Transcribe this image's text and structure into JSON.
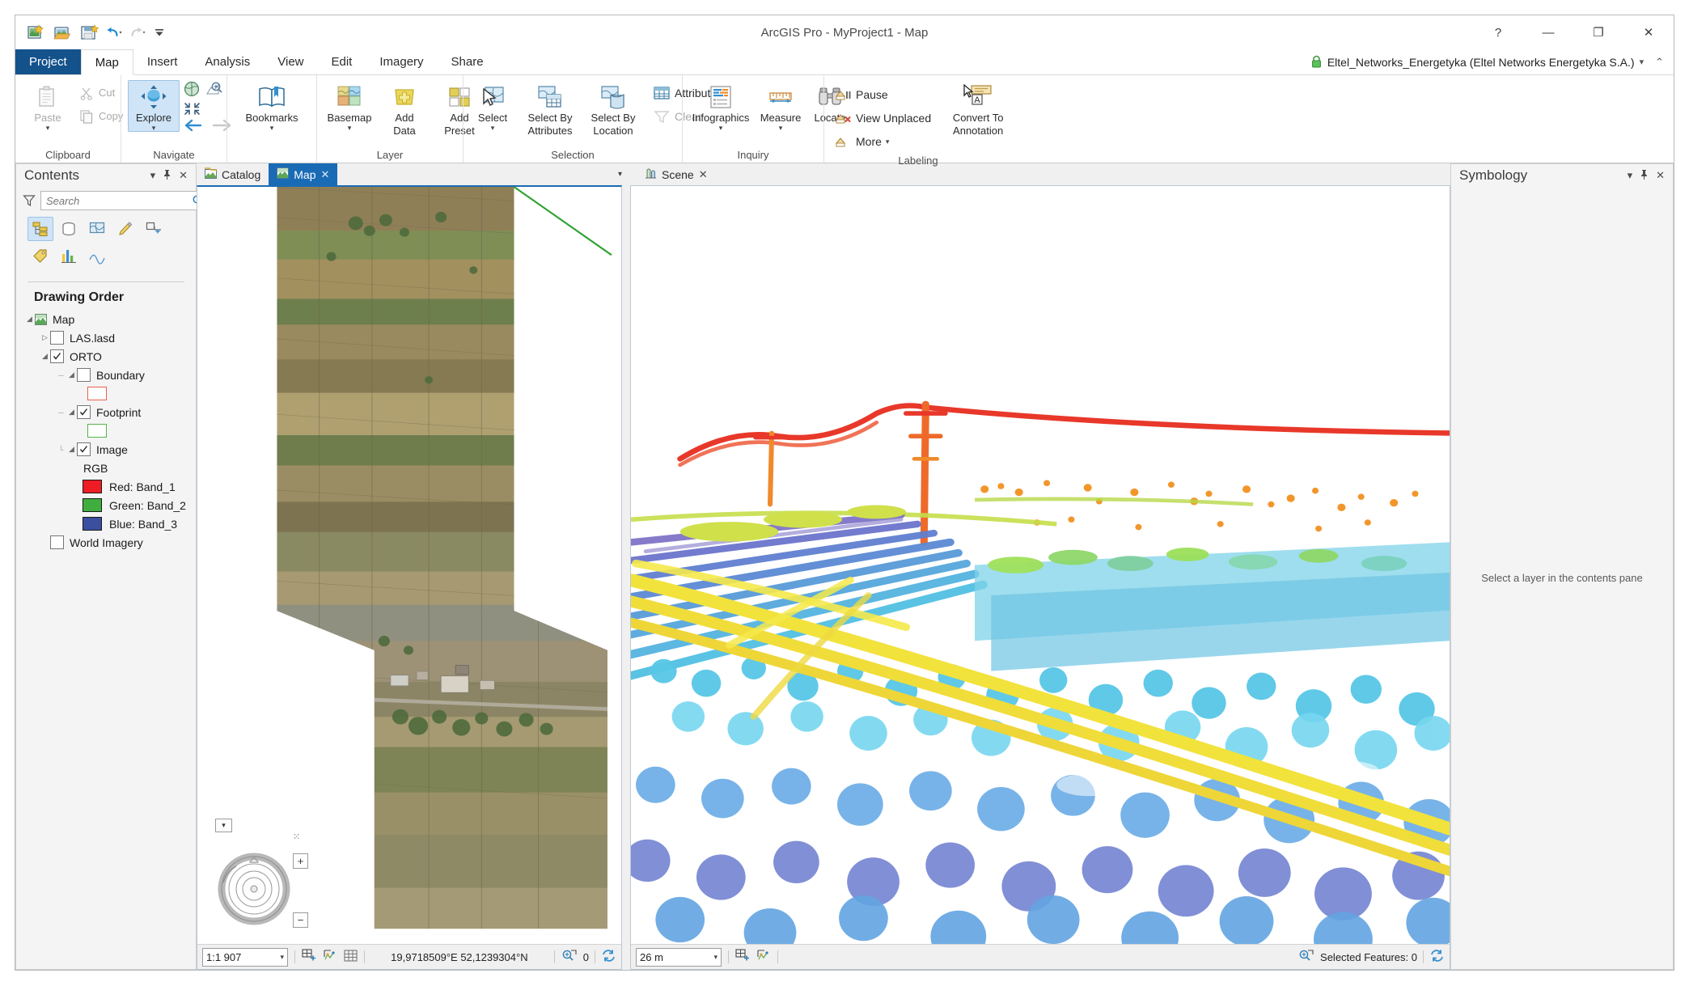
{
  "window": {
    "title": "ArcGIS Pro - MyProject1 - Map",
    "help_label": "?",
    "minimize_label": "—",
    "restore_label": "❐",
    "close_label": "✕"
  },
  "quick_access": [
    {
      "name": "new-project-icon",
      "label": "New Project"
    },
    {
      "name": "open-project-icon",
      "label": "Open Project"
    },
    {
      "name": "save-project-icon",
      "label": "Save Project"
    },
    {
      "name": "undo-icon",
      "label": "Undo"
    },
    {
      "name": "redo-icon",
      "label": "Redo"
    },
    {
      "name": "customize-quick-access-icon",
      "label": "Customize Quick Access Toolbar"
    }
  ],
  "ribbon_tabs": [
    {
      "label": "Project",
      "state": "project"
    },
    {
      "label": "Map",
      "state": "active"
    },
    {
      "label": "Insert",
      "state": "normal"
    },
    {
      "label": "Analysis",
      "state": "normal"
    },
    {
      "label": "View",
      "state": "normal"
    },
    {
      "label": "Edit",
      "state": "normal"
    },
    {
      "label": "Imagery",
      "state": "normal"
    },
    {
      "label": "Share",
      "state": "normal"
    }
  ],
  "account": {
    "name": "Eltel_Networks_Energetyka (Eltel Networks Energetyka S.A.)",
    "caret": "▾",
    "collapse_caret": "⌃"
  },
  "ribbon_groups": [
    {
      "name": "clipboard",
      "label": "Clipboard",
      "has_dialog_launcher": true,
      "buttons": [
        {
          "name": "paste-button",
          "label": "Paste",
          "dimmed": true,
          "caret": true
        },
        {
          "name": "cut-button",
          "label": "Cut",
          "dimmed": true
        },
        {
          "name": "copy-button",
          "label": "Copy",
          "dimmed": true
        }
      ]
    },
    {
      "name": "navigate",
      "label": "Navigate",
      "has_dialog_launcher": true,
      "buttons": [
        {
          "name": "explore-button",
          "label": "Explore",
          "selected": true,
          "caret": true
        },
        {
          "name": "full-extent-button",
          "label": ""
        },
        {
          "name": "fixed-zoom-in-button",
          "label": ""
        },
        {
          "name": "previous-extent-button",
          "label": ""
        },
        {
          "name": "next-extent-button",
          "label": ""
        }
      ]
    },
    {
      "name": "bookmarks-group",
      "label": "",
      "buttons": [
        {
          "name": "bookmarks-button",
          "label": "Bookmarks",
          "caret": true
        }
      ]
    },
    {
      "name": "layer",
      "label": "Layer",
      "buttons": [
        {
          "name": "basemap-button",
          "label": "Basemap",
          "caret": true
        },
        {
          "name": "add-data-button",
          "label": "Add",
          "label2": "Data",
          "caret": true
        },
        {
          "name": "add-preset-button",
          "label": "Add",
          "label2": "Preset",
          "caret": true
        }
      ]
    },
    {
      "name": "selection",
      "label": "Selection",
      "has_dialog_launcher": true,
      "buttons": [
        {
          "name": "select-button",
          "label": "Select",
          "caret": true
        },
        {
          "name": "select-by-attributes-button",
          "label": "Select By",
          "label2": "Attributes"
        },
        {
          "name": "select-by-location-button",
          "label": "Select By",
          "label2": "Location"
        },
        {
          "name": "attributes-button",
          "label": "Attributes"
        },
        {
          "name": "clear-button",
          "label": "Clear",
          "dimmed": true
        }
      ]
    },
    {
      "name": "inquiry",
      "label": "Inquiry",
      "buttons": [
        {
          "name": "infographics-button",
          "label": "Infographics",
          "caret": true
        },
        {
          "name": "measure-button",
          "label": "Measure",
          "caret": true
        },
        {
          "name": "locate-button",
          "label": "Locate"
        }
      ]
    },
    {
      "name": "labeling",
      "label": "Labeling",
      "buttons": [
        {
          "name": "pause-labeling-button",
          "label": "Pause"
        },
        {
          "name": "view-unplaced-button",
          "label": "View Unplaced"
        },
        {
          "name": "more-labeling-button",
          "label": "More",
          "caret": true
        },
        {
          "name": "convert-to-annotation-button",
          "label": "Convert To",
          "label2": "Annotation"
        }
      ]
    }
  ],
  "contents_pane": {
    "title": "Contents",
    "collapse_caret": "▾",
    "pin_glyph": "✕",
    "pin_icon": "pin",
    "search": {
      "placeholder": "Search",
      "value": ""
    },
    "tool_buttons": [
      {
        "name": "list-by-drawing-order-icon",
        "selected": true
      },
      {
        "name": "list-by-data-source-icon",
        "selected": false
      },
      {
        "name": "list-by-selection-icon",
        "selected": false
      },
      {
        "name": "list-by-editing-icon",
        "selected": false
      },
      {
        "name": "list-by-snapping-icon",
        "selected": false
      },
      {
        "name": "list-by-labeling-icon",
        "selected": false
      },
      {
        "name": "list-by-charts-icon",
        "selected": false
      },
      {
        "name": "list-by-range-icon",
        "selected": false
      }
    ],
    "section_title": "Drawing Order",
    "tree": [
      {
        "name": "map-node",
        "label": "Map",
        "indent": 0,
        "expander": "down",
        "icon": "map-icon",
        "checkbox": "none"
      },
      {
        "name": "las-lasd-layer",
        "label": "LAS.lasd",
        "indent": 1,
        "expander": "right",
        "checkbox": "unchecked"
      },
      {
        "name": "orto-layer",
        "label": "ORTO",
        "indent": 1,
        "expander": "down",
        "checkbox": "checked"
      },
      {
        "name": "boundary-sublayer",
        "label": "Boundary",
        "indent": 2,
        "expander": "down",
        "checkbox": "unchecked"
      },
      {
        "name": "boundary-symbol-swatch",
        "label": "",
        "indent": 3,
        "swatch": "#ffffff",
        "swatch_border": "#e8614d"
      },
      {
        "name": "footprint-sublayer",
        "label": "Footprint",
        "indent": 2,
        "expander": "down",
        "checkbox": "checked"
      },
      {
        "name": "footprint-symbol-swatch",
        "label": "",
        "indent": 3,
        "swatch": "#ffffff",
        "swatch_border": "#55b449"
      },
      {
        "name": "image-sublayer",
        "label": "Image",
        "indent": 2,
        "expander": "down",
        "checkbox": "checked"
      },
      {
        "name": "rgb-heading",
        "label": "RGB",
        "indent": 3
      },
      {
        "name": "band-red-item",
        "label": "Red:   Band_1",
        "indent": 3,
        "swatch": "#ee1c24",
        "swatch_border": "#1a1a1a"
      },
      {
        "name": "band-green-item",
        "label": "Green: Band_2",
        "indent": 3,
        "swatch": "#3fae3f",
        "swatch_border": "#1a1a1a"
      },
      {
        "name": "band-blue-item",
        "label": "Blue:  Band_3",
        "indent": 3,
        "swatch": "#3a4fa0",
        "swatch_border": "#1a1a1a"
      },
      {
        "name": "world-imagery-layer",
        "label": "World Imagery",
        "indent": 1,
        "checkbox": "unchecked"
      }
    ]
  },
  "view_tabs_left": [
    {
      "name": "tab-catalog",
      "label": "Catalog",
      "icon": "catalog-icon",
      "active": false,
      "closable": false
    },
    {
      "name": "tab-map",
      "label": "Map",
      "icon": "map-icon",
      "active": true,
      "closable": true
    }
  ],
  "view_tabs_right": [
    {
      "name": "tab-scene",
      "label": "Scene",
      "icon": "scene-icon",
      "active": false,
      "closable": true
    }
  ],
  "tab_overflow_caret": "▾",
  "map_view": {
    "name": "map-view",
    "status": {
      "scale": "1:1 907",
      "scale_caret": "▾",
      "coordinates": "19,9718509°E 52,1239304°N",
      "selected_count": "0",
      "tools": [
        "add-new-map-icon",
        "select-features-icon",
        "show-grid-icon"
      ],
      "refresh_icon": "refresh-icon",
      "selection_icon": "selection-icon"
    },
    "nav": {
      "zoom_in_label": "+",
      "zoom_out_label": "−",
      "overview_label": "▾",
      "crosshair_label": "⁙"
    }
  },
  "scene_view": {
    "name": "scene-view",
    "status": {
      "scale": "26 m",
      "scale_caret": "▾",
      "selected_features_label": "Selected Features: 0",
      "tools": [
        "add-new-map-icon",
        "select-features-icon"
      ],
      "refresh_icon": "refresh-icon",
      "selection_icon": "selection-icon"
    }
  },
  "symbology_pane": {
    "title": "Symbology",
    "collapse_caret": "▾",
    "pin_glyph": "✕",
    "empty_message": "Select a layer in the contents pane"
  },
  "colors": {
    "accent": "#14528c",
    "tab_active": "#1a6bb5",
    "ribbon_bg": "#ffffff",
    "pane_bg": "#f4f4f4",
    "window_bg": "#f0f0f0"
  }
}
